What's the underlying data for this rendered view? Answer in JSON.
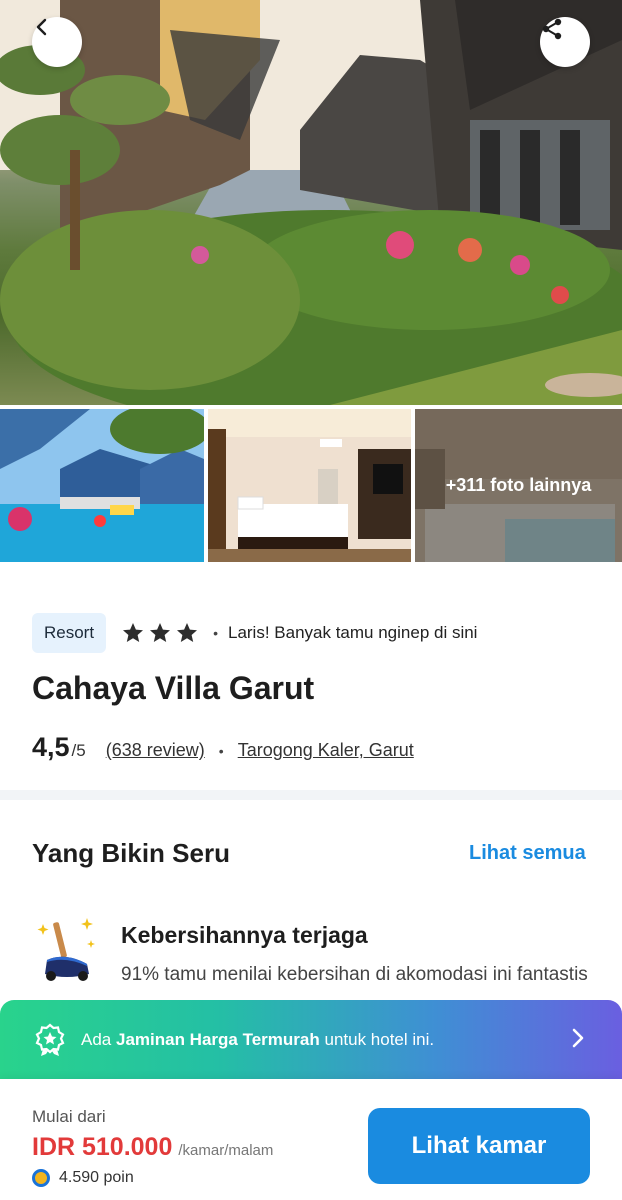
{
  "gallery": {
    "hero_alt": "Resort garden and villas",
    "more_photos": "+311 foto lainnya",
    "icons": {
      "back": "chevron-left-icon",
      "share": "share-icon"
    }
  },
  "hotel": {
    "type_badge": "Resort",
    "stars": 3,
    "popular_text": "Laris! Banyak tamu nginep di sini",
    "name": "Cahaya Villa Garut",
    "rating": "4,5",
    "rating_max": "/5",
    "reviews": "(638 review)",
    "location": "Tarogong Kaler, Garut"
  },
  "highlights": {
    "title": "Yang Bikin Seru",
    "see_all": "Lihat semua",
    "items": [
      {
        "icon": "cleaning-broom-icon",
        "title": "Kebersihannya terjaga",
        "description": "91% tamu menilai kebersihan di akomodasi ini fantastis"
      }
    ]
  },
  "banner": {
    "icon": "medal-badge-icon",
    "prefix": "Ada",
    "highlight": "Jaminan Harga Termurah",
    "suffix": "untuk hotel ini."
  },
  "booking": {
    "from_label": "Mulai dari",
    "price": "IDR 510.000",
    "per_unit": "/kamar/malam",
    "points": "4.590 poin",
    "cta_label": "Lihat kamar"
  },
  "colors": {
    "accent_blue": "#1a8be0",
    "price_red": "#e23a3a",
    "badge_bg": "#e6f2fd"
  }
}
